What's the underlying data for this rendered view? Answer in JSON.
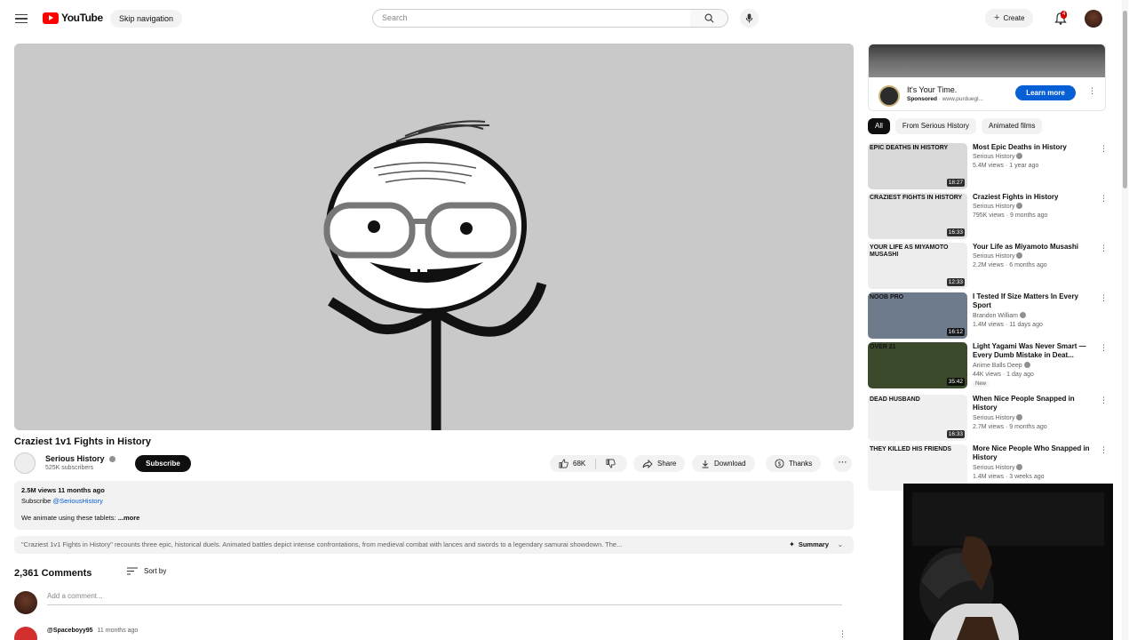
{
  "header": {
    "logo_text": "YouTube",
    "skip_nav": "Skip navigation",
    "search_placeholder": "Search",
    "create_label": "Create",
    "notification_count": "4"
  },
  "video": {
    "title": "Craziest 1v1 Fights in History",
    "channel_name": "Serious History",
    "channel_subs": "525K subscribers",
    "subscribe_label": "Subscribe",
    "likes": "68K",
    "share_label": "Share",
    "download_label": "Download",
    "thanks_label": "Thanks",
    "stats": "2.5M views  11 months ago",
    "subscribe_line_prefix": "Subscribe",
    "subscribe_handle": "@SeriousHistory",
    "desc_text": "We animate using these tablets:",
    "desc_more": "...more",
    "summary_text": "\"Craziest 1v1 Fights in History\" recounts three epic, historical duels. Animated battles depict intense confrontations, from medieval combat with lances and swords to a legendary samurai showdown. The...",
    "summary_label": "Summary"
  },
  "comments": {
    "count": "2,361 Comments",
    "sort_label": "Sort by",
    "add_placeholder": "Add a comment...",
    "first_author": "@Spaceboyy95",
    "first_time": "11 months ago"
  },
  "ad": {
    "title": "It's Your Time.",
    "sponsored": "Sponsored",
    "domain": "· www.purduegl...",
    "cta": "Learn more"
  },
  "chips": [
    "All",
    "From Serious History",
    "Animated films"
  ],
  "recommendations": [
    {
      "title": "Most Epic Deaths in History",
      "channel": "Serious History",
      "meta": "5.4M views · 1 year ago",
      "duration": "18:27",
      "caption": "EPIC DEATHS IN HISTORY",
      "thumb_color": "#d9d9d9"
    },
    {
      "title": "Craziest Fights in History",
      "channel": "Serious History",
      "meta": "795K views · 9 months ago",
      "duration": "16:33",
      "caption": "CRAZIEST FIGHTS IN HISTORY",
      "thumb_color": "#e3e3e3"
    },
    {
      "title": "Your Life as Miyamoto Musashi",
      "channel": "Serious History",
      "meta": "2.2M views · 6 months ago",
      "duration": "12:33",
      "caption": "YOUR LIFE AS MIYAMOTO MUSASHI",
      "thumb_color": "#ededed"
    },
    {
      "title": "I Tested If Size Matters In Every Sport",
      "channel": "Brandon William",
      "meta": "1.4M views · 11 days ago",
      "duration": "16:12",
      "caption": "NOOB  PRO",
      "thumb_color": "#6d7b8c"
    },
    {
      "title": "Light Yagami Was Never Smart —Every Dumb Mistake in Deat...",
      "channel": "Anime Balls Deep",
      "meta": "44K views · 1 day ago",
      "duration": "35:42",
      "caption": "OVER 21",
      "thumb_color": "#3b4a2a",
      "is_new": "New"
    },
    {
      "title": "When Nice People Snapped in History",
      "channel": "Serious History",
      "meta": "2.7M views · 9 months ago",
      "duration": "16:33",
      "caption": "DEAD HUSBAND",
      "thumb_color": "#f0f0f0"
    },
    {
      "title": "More Nice People Who Snapped in History",
      "channel": "Serious History",
      "meta": "1.4M views · 3 weeks ago",
      "duration": "",
      "caption": "THEY KILLED HIS FRIENDS",
      "thumb_color": "#f2f2f2"
    }
  ]
}
